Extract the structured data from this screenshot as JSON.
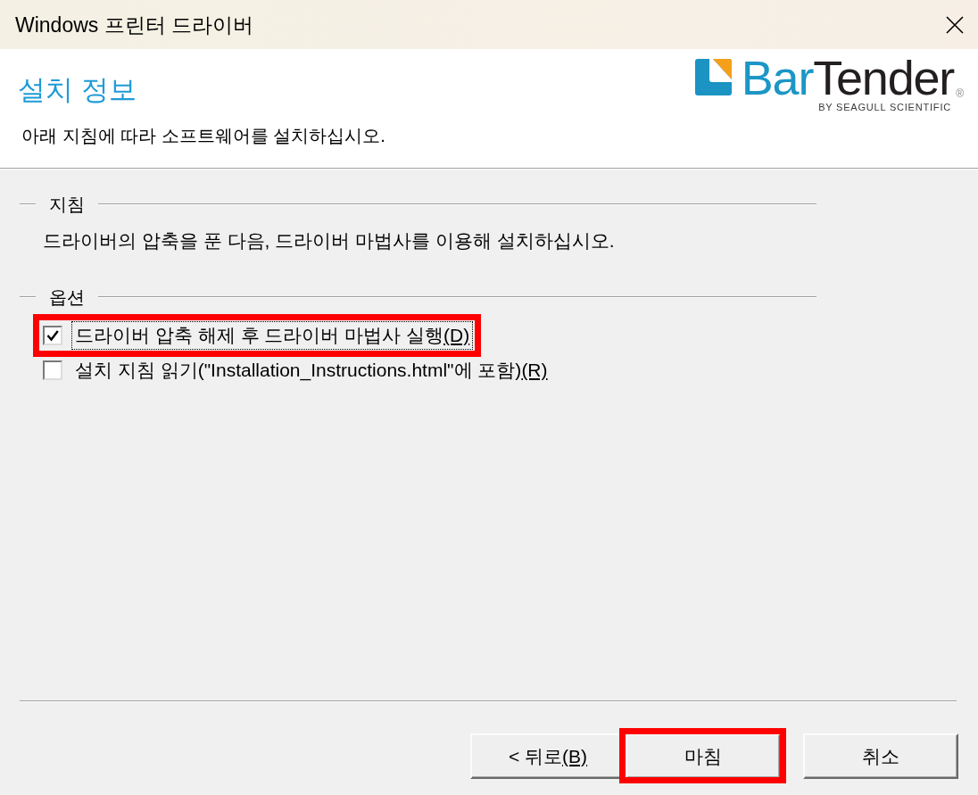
{
  "window": {
    "title": "Windows 프린터 드라이버"
  },
  "header": {
    "title": "설치 정보",
    "subtitle": "아래 지침에 따라 소프트웨어를 설치하십시오.",
    "logo": {
      "wordmark_first": "Bar",
      "wordmark_second": "Tender",
      "registered_mark": "®",
      "tagline": "BY SEAGULL SCIENTIFIC"
    }
  },
  "groups": [
    {
      "kind": "text",
      "title": "지침",
      "text": "드라이버의 압축을 푼 다음, 드라이버 마법사를 이용해 설치하십시오."
    },
    {
      "kind": "options",
      "title": "옵션",
      "options": [
        {
          "label": "드라이버 압축 해제 후 드라이버 마법사 실행",
          "access_key": "(D)",
          "checked": true,
          "focused": true,
          "highlighted": true
        },
        {
          "label": "설치 지침 읽기(\"Installation_Instructions.html\"에 포함)",
          "access_key": "(R)",
          "checked": false,
          "focused": false,
          "highlighted": false
        }
      ]
    }
  ],
  "buttons": [
    {
      "label": "< 뒤로",
      "access_key": "(B)",
      "highlighted": false
    },
    {
      "label": "마침",
      "highlighted": true
    },
    {
      "label": "취소",
      "highlighted": false
    }
  ]
}
